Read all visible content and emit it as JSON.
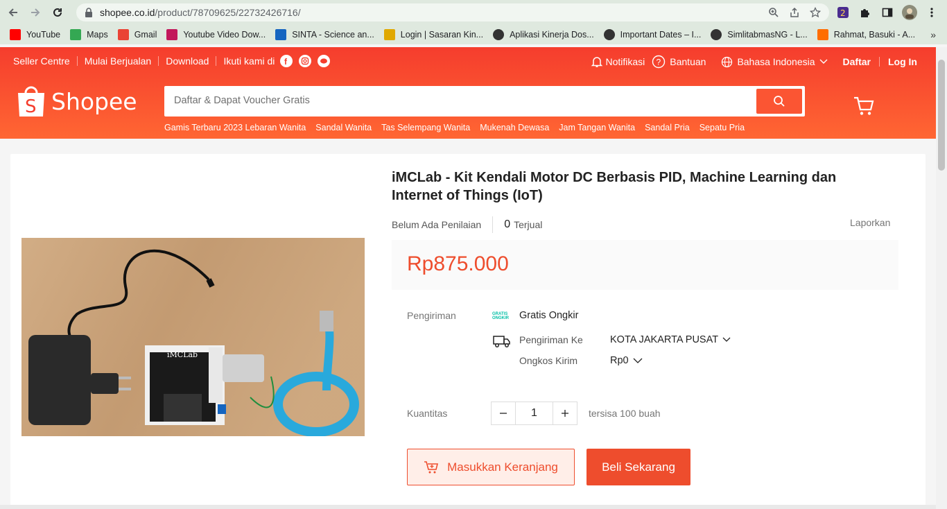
{
  "browser": {
    "url_host": "shopee.co.id",
    "url_path": "/product/78709625/22732426716/",
    "bookmarks": [
      {
        "label": "YouTube",
        "icon": "youtube-icon",
        "color": "#ff0000"
      },
      {
        "label": "Maps",
        "icon": "maps-icon",
        "color": "#34a853"
      },
      {
        "label": "Gmail",
        "icon": "gmail-icon",
        "color": "#ea4335"
      },
      {
        "label": "Youtube Video Dow...",
        "icon": "download-icon",
        "color": "#c2185b"
      },
      {
        "label": "SINTA - Science an...",
        "icon": "sinta-icon",
        "color": "#1565c0"
      },
      {
        "label": "Login | Sasaran Kin...",
        "icon": "login-icon",
        "color": "#e0a800"
      },
      {
        "label": "Aplikasi Kinerja Dos...",
        "icon": "globe-icon",
        "color": "#333333"
      },
      {
        "label": "Important Dates – I...",
        "icon": "globe-icon",
        "color": "#333333"
      },
      {
        "label": "SimlitabmasNG - L...",
        "icon": "globe-icon",
        "color": "#333333"
      },
      {
        "label": "Rahmat, Basuki - A...",
        "icon": "sc-icon",
        "color": "#ff6d00"
      }
    ],
    "more": "»"
  },
  "header": {
    "topnav_left": [
      "Seller Centre",
      "Mulai Berjualan",
      "Download",
      "Ikuti kami di"
    ],
    "notif": "Notifikasi",
    "help": "Bantuan",
    "language": "Bahasa Indonesia",
    "register": "Daftar",
    "login": "Log In",
    "logo_text": "Shopee",
    "search_placeholder": "Daftar & Dapat Voucher Gratis",
    "suggestions": [
      "Gamis Terbaru 2023 Lebaran Wanita",
      "Sandal Wanita",
      "Tas Selempang Wanita",
      "Mukenah Dewasa",
      "Jam Tangan Wanita",
      "Sandal Pria",
      "Sepatu Pria"
    ]
  },
  "product": {
    "title": "iMCLab - Kit Kendali Motor DC Berbasis PID, Machine Learning dan Internet of Things (IoT)",
    "rating_text": "Belum Ada Penilaian",
    "sold_count": "0",
    "sold_label": "Terjual",
    "report": "Laporkan",
    "price": "Rp875.000",
    "shipping_label": "Pengiriman",
    "free_shipping": "Gratis Ongkir",
    "shipping_to_label": "Pengiriman Ke",
    "shipping_to_value": "KOTA JAKARTA PUSAT",
    "shipping_cost_label": "Ongkos Kirim",
    "shipping_cost_value": "Rp0",
    "qty_label": "Kuantitas",
    "qty_value": "1",
    "stock_text": "tersisa 100 buah",
    "add_to_cart": "Masukkan Keranjang",
    "buy_now": "Beli Sekarang",
    "gratis_logo_1": "GRATIS",
    "gratis_logo_2": "ONGKIR",
    "board_label": "iMCLab"
  },
  "colors": {
    "brand": "#ee4d2d",
    "header_start": "#f53d2d",
    "header_end": "#ff6633"
  }
}
